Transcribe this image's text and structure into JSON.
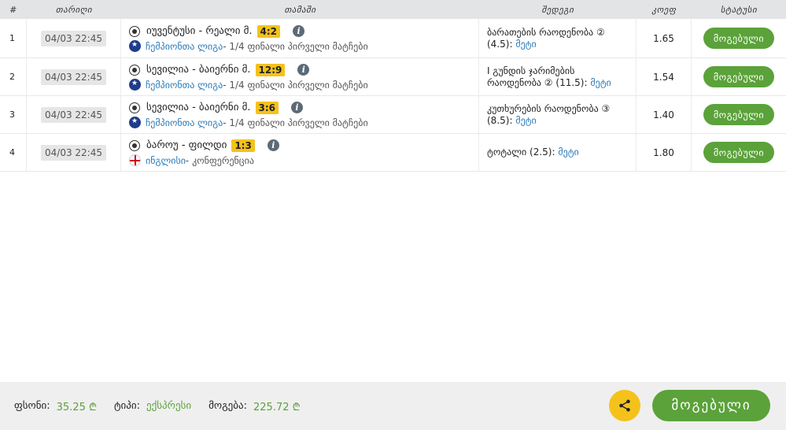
{
  "columns": {
    "num": "#",
    "date": "თარიღი",
    "match": "თამაში",
    "bet": "შედეგი",
    "odds": "კოეფ",
    "status": "სტატუსი"
  },
  "rows": [
    {
      "num": "1",
      "date": "04/03 22:45",
      "teams": "იუვენტუსი - რეალი მ.",
      "score": "4:2",
      "league": "ჩემპიონთა ლიგა",
      "stage": " - 1/4 ფინალი პირველი მატჩები",
      "bet_line1": "ბარათების რაოდენობა ②",
      "bet_line2": "(4.5): ",
      "more": "მეტი",
      "odds": "1.65",
      "status": "მოგებული",
      "league_icon": "champions-league-icon"
    },
    {
      "num": "2",
      "date": "04/03 22:45",
      "teams": "სევილია - ბაიერნი მ.",
      "score": "12:9",
      "league": "ჩემპიონთა ლიგა",
      "stage": " - 1/4 ფინალი პირველი მატჩები",
      "bet_line1": "I გუნდის ჯარიმების",
      "bet_line2": "რაოდენობა ② (11.5): ",
      "more": "მეტი",
      "odds": "1.54",
      "status": "მოგებული",
      "league_icon": "champions-league-icon"
    },
    {
      "num": "3",
      "date": "04/03 22:45",
      "teams": "სევილია - ბაიერნი მ.",
      "score": "3:6",
      "league": "ჩემპიონთა ლიგა",
      "stage": " - 1/4 ფინალი პირველი მატჩები",
      "bet_line1": "კუთხურების რაოდენობა ③",
      "bet_line2": "(8.5): ",
      "more": "მეტი",
      "odds": "1.40",
      "status": "მოგებული",
      "league_icon": "champions-league-icon"
    },
    {
      "num": "4",
      "date": "04/03 22:45",
      "teams": "ბაროუ - ფილდი",
      "score": "1:3",
      "league": "ინგლისი",
      "stage": " - კონფერენცია",
      "bet_line1": "",
      "bet_line2": "ტოტალი (2.5): ",
      "more": "მეტი",
      "odds": "1.80",
      "status": "მოგებული",
      "league_icon": "england-flag-icon"
    }
  ],
  "footer": {
    "stake_label": "ფსონი:",
    "stake_value": "35.25 ₾",
    "type_label": "ტიპი:",
    "type_value": "ექსპრესი",
    "win_label": "მოგება:",
    "win_value": "225.72 ₾",
    "status_label": "მოგებული"
  },
  "colors": {
    "win_green": "#5ba23a",
    "score_yellow": "#f4c21b",
    "link_blue": "#2a7ab8"
  }
}
